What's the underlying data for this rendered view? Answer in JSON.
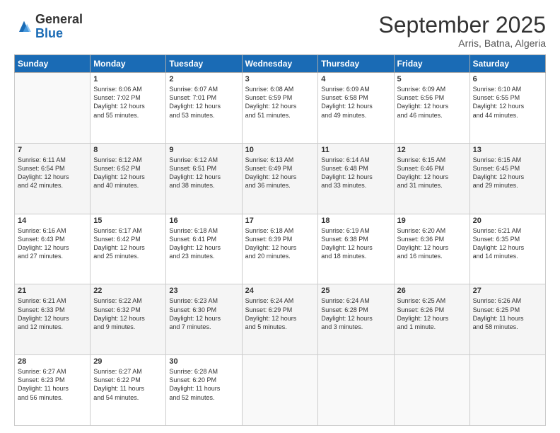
{
  "logo": {
    "general": "General",
    "blue": "Blue"
  },
  "header": {
    "month": "September 2025",
    "location": "Arris, Batna, Algeria"
  },
  "weekdays": [
    "Sunday",
    "Monday",
    "Tuesday",
    "Wednesday",
    "Thursday",
    "Friday",
    "Saturday"
  ],
  "weeks": [
    [
      {
        "day": "",
        "info": ""
      },
      {
        "day": "1",
        "info": "Sunrise: 6:06 AM\nSunset: 7:02 PM\nDaylight: 12 hours\nand 55 minutes."
      },
      {
        "day": "2",
        "info": "Sunrise: 6:07 AM\nSunset: 7:01 PM\nDaylight: 12 hours\nand 53 minutes."
      },
      {
        "day": "3",
        "info": "Sunrise: 6:08 AM\nSunset: 6:59 PM\nDaylight: 12 hours\nand 51 minutes."
      },
      {
        "day": "4",
        "info": "Sunrise: 6:09 AM\nSunset: 6:58 PM\nDaylight: 12 hours\nand 49 minutes."
      },
      {
        "day": "5",
        "info": "Sunrise: 6:09 AM\nSunset: 6:56 PM\nDaylight: 12 hours\nand 46 minutes."
      },
      {
        "day": "6",
        "info": "Sunrise: 6:10 AM\nSunset: 6:55 PM\nDaylight: 12 hours\nand 44 minutes."
      }
    ],
    [
      {
        "day": "7",
        "info": "Sunrise: 6:11 AM\nSunset: 6:54 PM\nDaylight: 12 hours\nand 42 minutes."
      },
      {
        "day": "8",
        "info": "Sunrise: 6:12 AM\nSunset: 6:52 PM\nDaylight: 12 hours\nand 40 minutes."
      },
      {
        "day": "9",
        "info": "Sunrise: 6:12 AM\nSunset: 6:51 PM\nDaylight: 12 hours\nand 38 minutes."
      },
      {
        "day": "10",
        "info": "Sunrise: 6:13 AM\nSunset: 6:49 PM\nDaylight: 12 hours\nand 36 minutes."
      },
      {
        "day": "11",
        "info": "Sunrise: 6:14 AM\nSunset: 6:48 PM\nDaylight: 12 hours\nand 33 minutes."
      },
      {
        "day": "12",
        "info": "Sunrise: 6:15 AM\nSunset: 6:46 PM\nDaylight: 12 hours\nand 31 minutes."
      },
      {
        "day": "13",
        "info": "Sunrise: 6:15 AM\nSunset: 6:45 PM\nDaylight: 12 hours\nand 29 minutes."
      }
    ],
    [
      {
        "day": "14",
        "info": "Sunrise: 6:16 AM\nSunset: 6:43 PM\nDaylight: 12 hours\nand 27 minutes."
      },
      {
        "day": "15",
        "info": "Sunrise: 6:17 AM\nSunset: 6:42 PM\nDaylight: 12 hours\nand 25 minutes."
      },
      {
        "day": "16",
        "info": "Sunrise: 6:18 AM\nSunset: 6:41 PM\nDaylight: 12 hours\nand 23 minutes."
      },
      {
        "day": "17",
        "info": "Sunrise: 6:18 AM\nSunset: 6:39 PM\nDaylight: 12 hours\nand 20 minutes."
      },
      {
        "day": "18",
        "info": "Sunrise: 6:19 AM\nSunset: 6:38 PM\nDaylight: 12 hours\nand 18 minutes."
      },
      {
        "day": "19",
        "info": "Sunrise: 6:20 AM\nSunset: 6:36 PM\nDaylight: 12 hours\nand 16 minutes."
      },
      {
        "day": "20",
        "info": "Sunrise: 6:21 AM\nSunset: 6:35 PM\nDaylight: 12 hours\nand 14 minutes."
      }
    ],
    [
      {
        "day": "21",
        "info": "Sunrise: 6:21 AM\nSunset: 6:33 PM\nDaylight: 12 hours\nand 12 minutes."
      },
      {
        "day": "22",
        "info": "Sunrise: 6:22 AM\nSunset: 6:32 PM\nDaylight: 12 hours\nand 9 minutes."
      },
      {
        "day": "23",
        "info": "Sunrise: 6:23 AM\nSunset: 6:30 PM\nDaylight: 12 hours\nand 7 minutes."
      },
      {
        "day": "24",
        "info": "Sunrise: 6:24 AM\nSunset: 6:29 PM\nDaylight: 12 hours\nand 5 minutes."
      },
      {
        "day": "25",
        "info": "Sunrise: 6:24 AM\nSunset: 6:28 PM\nDaylight: 12 hours\nand 3 minutes."
      },
      {
        "day": "26",
        "info": "Sunrise: 6:25 AM\nSunset: 6:26 PM\nDaylight: 12 hours\nand 1 minute."
      },
      {
        "day": "27",
        "info": "Sunrise: 6:26 AM\nSunset: 6:25 PM\nDaylight: 11 hours\nand 58 minutes."
      }
    ],
    [
      {
        "day": "28",
        "info": "Sunrise: 6:27 AM\nSunset: 6:23 PM\nDaylight: 11 hours\nand 56 minutes."
      },
      {
        "day": "29",
        "info": "Sunrise: 6:27 AM\nSunset: 6:22 PM\nDaylight: 11 hours\nand 54 minutes."
      },
      {
        "day": "30",
        "info": "Sunrise: 6:28 AM\nSunset: 6:20 PM\nDaylight: 11 hours\nand 52 minutes."
      },
      {
        "day": "",
        "info": ""
      },
      {
        "day": "",
        "info": ""
      },
      {
        "day": "",
        "info": ""
      },
      {
        "day": "",
        "info": ""
      }
    ]
  ]
}
